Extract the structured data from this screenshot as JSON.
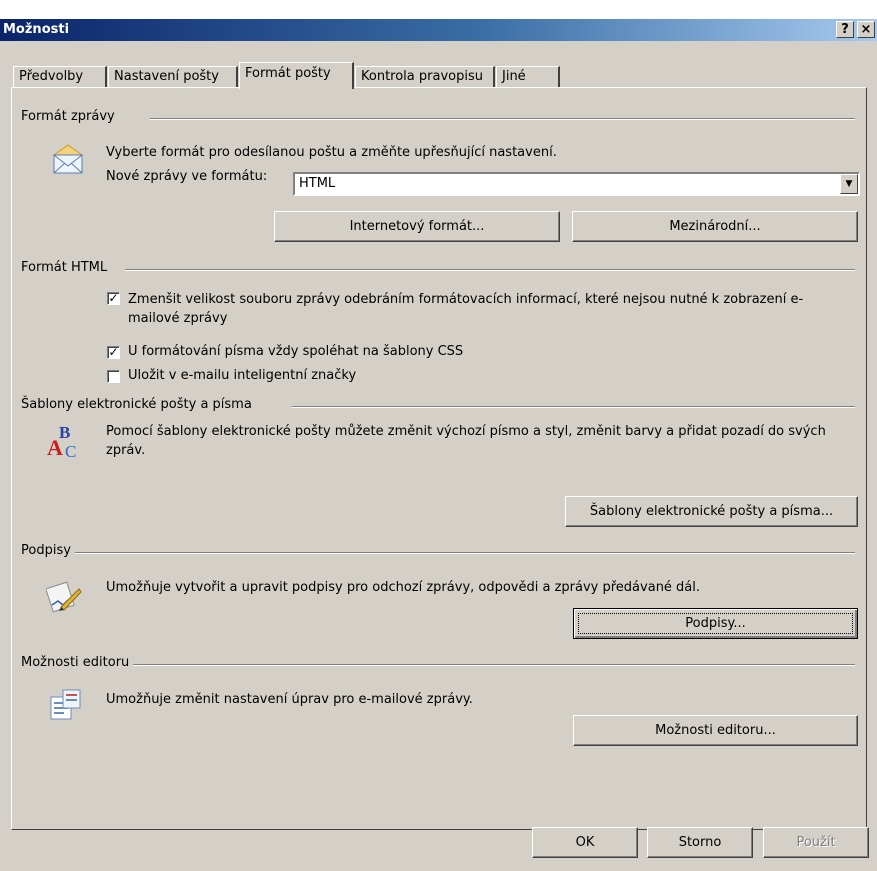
{
  "window": {
    "title": "Možnosti",
    "help_button": "?",
    "close_button": "×"
  },
  "tabs": [
    {
      "label": "Předvolby"
    },
    {
      "label": "Nastavení pošty"
    },
    {
      "label": "Formát pošty"
    },
    {
      "label": "Kontrola pravopisu"
    },
    {
      "label": "Jiné"
    }
  ],
  "message_format": {
    "group_label": "Formát zprávy",
    "description": "Vyberte formát pro odesílanou poštu a změňte upřesňující nastavení.",
    "compose_label": "Nové zprávy ve formátu:",
    "compose_value": "HTML",
    "internet_format_button": "Internetový formát...",
    "international_button": "Mezinárodní..."
  },
  "html_format": {
    "group_label": "Formát HTML",
    "options": [
      {
        "label": "Zmenšit velikost souboru zprávy odebráním formátovacích informací, které nejsou nutné k zobrazení e-mailové zprávy",
        "checked": true
      },
      {
        "label": "U formátování písma vždy spoléhat na šablony CSS",
        "checked": true
      },
      {
        "label": "Uložit v e-mailu inteligentní značky",
        "checked": false
      }
    ]
  },
  "stationery": {
    "group_label": "Šablony elektronické pošty a písma",
    "description": "Pomocí šablony elektronické pošty můžete změnit výchozí písmo a styl, změnit barvy a přidat pozadí do svých zpráv.",
    "button": "Šablony elektronické pošty a písma..."
  },
  "signatures": {
    "group_label": "Podpisy",
    "description": "Umožňuje vytvořit a upravit podpisy pro odchozí zprávy, odpovědi a zprávy předávané dál.",
    "button": "Podpisy..."
  },
  "editor": {
    "group_label": "Možnosti editoru",
    "description": "Umožňuje změnit nastavení úprav pro e-mailové zprávy.",
    "button": "Možnosti editoru..."
  },
  "footer": {
    "ok": "OK",
    "cancel": "Storno",
    "apply": "Použít"
  },
  "colors": {
    "titlebar_start": "#0a246a",
    "titlebar_end": "#a6caf0",
    "face": "#d4d0c8"
  }
}
